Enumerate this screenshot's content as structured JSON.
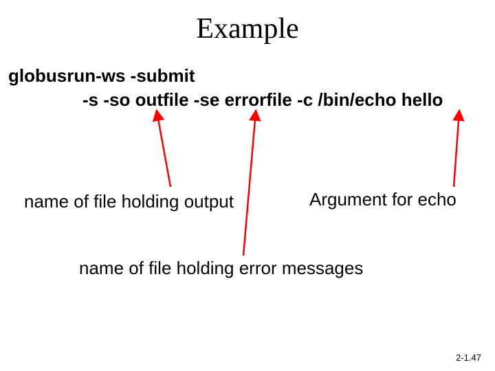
{
  "title": "Example",
  "command": {
    "line1": "globusrun-ws  -submit",
    "line2": "-s -so outfile -se errorfile -c /bin/echo hello"
  },
  "labels": {
    "output": "name of file holding output",
    "argument": "Argument for echo",
    "error": "name of file holding error messages"
  },
  "footer": "2-1.47",
  "arrows": {
    "color": "#ff0000"
  }
}
